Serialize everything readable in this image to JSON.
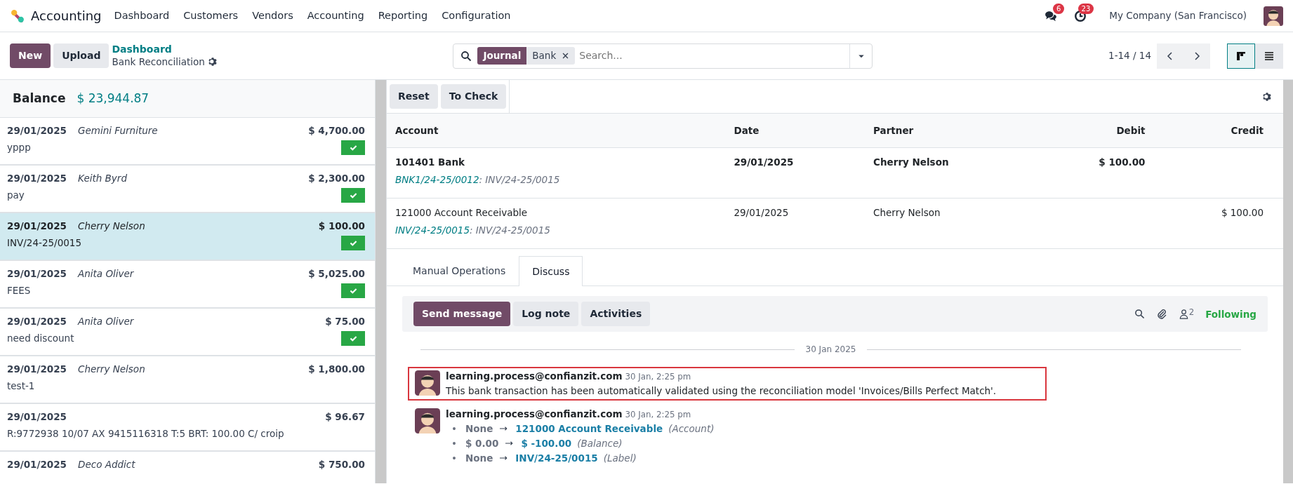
{
  "app": {
    "name": "Accounting"
  },
  "menu": [
    "Dashboard",
    "Customers",
    "Vendors",
    "Accounting",
    "Reporting",
    "Configuration"
  ],
  "systray": {
    "messages_count": "6",
    "activities_count": "23",
    "company": "My Company (San Francisco)"
  },
  "control_panel": {
    "buttons": [
      "New",
      "Upload"
    ],
    "breadcrumb": "Dashboard",
    "title": "Bank Reconciliation",
    "search": {
      "facet_label": "Journal",
      "facet_value": "Bank",
      "placeholder": "Search..."
    },
    "pager": "1-14 / 14",
    "views": [
      {
        "kind": "kanban",
        "selected": true
      },
      {
        "kind": "list",
        "selected": false
      }
    ]
  },
  "balance": {
    "label": "Balance",
    "amount": "$ 23,944.87"
  },
  "transactions": [
    {
      "date": "29/01/2025",
      "partner": "Gemini Furniture",
      "amount": "$ 4,700.00",
      "label": "yppp",
      "selected": false,
      "validated": true
    },
    {
      "date": "29/01/2025",
      "partner": "Keith Byrd",
      "amount": "$ 2,300.00",
      "label": "pay",
      "selected": false,
      "validated": true
    },
    {
      "date": "29/01/2025",
      "partner": "Cherry Nelson",
      "amount": "$ 100.00",
      "label": "INV/24-25/0015",
      "selected": true,
      "validated": true
    },
    {
      "date": "29/01/2025",
      "partner": "Anita Oliver",
      "amount": "$ 5,025.00",
      "label": "FEES",
      "selected": false,
      "validated": true
    },
    {
      "date": "29/01/2025",
      "partner": "Anita Oliver",
      "amount": "$ 75.00",
      "label": "need discount",
      "selected": false,
      "validated": true
    },
    {
      "date": "29/01/2025",
      "partner": "Cherry Nelson",
      "amount": "$ 1,800.00",
      "label": "test-1",
      "selected": false,
      "validated": false
    },
    {
      "date": "29/01/2025",
      "amount": "$ 96.67",
      "label": "R:9772938 10/07 AX 9415116318 T:5 BRT: 100.00 C/ croip",
      "selected": false,
      "validated": false
    },
    {
      "date": "29/01/2025",
      "partner": "Deco Addict",
      "amount": "$ 750.00",
      "selected": false,
      "validated": false
    }
  ],
  "actions": [
    "Reset",
    "To Check"
  ],
  "table": {
    "columns": [
      "Account",
      "Date",
      "Partner",
      "Debit",
      "Credit"
    ],
    "rows": [
      {
        "account": "101401 Bank",
        "ref": "BNK1/24-25/0012",
        "ref_detail": ": INV/24-25/0015",
        "date": "29/01/2025",
        "partner": "Cherry Nelson",
        "debit": "$ 100.00",
        "bold": true
      },
      {
        "account": "121000 Account Receivable",
        "ref": "INV/24-25/0015",
        "ref_detail": ": INV/24-25/0015",
        "date": "29/01/2025",
        "partner": "Cherry Nelson",
        "credit": "$ 100.00",
        "bold": false
      }
    ]
  },
  "tabs": [
    {
      "label": "Manual Operations",
      "selected": false
    },
    {
      "label": "Discuss",
      "selected": true
    }
  ],
  "chatter": {
    "buttons": [
      {
        "label": "Send message",
        "selected": true
      },
      {
        "label": "Log note",
        "selected": false
      },
      {
        "label": "Activities",
        "selected": false
      }
    ],
    "followers_count": "2",
    "follow_status": "Following",
    "date": "30 Jan 2025",
    "messages": [
      {
        "kind": "text",
        "author": "learning.process@confianzit.com",
        "time": "30 Jan, 2:25 pm",
        "body": "This bank transaction has been automatically validated using the reconciliation model 'Invoices/Bills Perfect Match'.",
        "highlighted": true
      },
      {
        "kind": "tracking",
        "author": "learning.process@confianzit.com",
        "time": "30 Jan, 2:25 pm",
        "changes": [
          {
            "marker": "•",
            "old": "None",
            "new": "121000 Account Receivable",
            "field": "(Account)"
          },
          {
            "marker": "•",
            "old": "$ 0.00",
            "new": "$ -100.00",
            "field": "(Balance)"
          },
          {
            "marker": "•",
            "old": "None",
            "new": "INV/24-25/0015",
            "field": "(Label)"
          }
        ]
      }
    ]
  }
}
